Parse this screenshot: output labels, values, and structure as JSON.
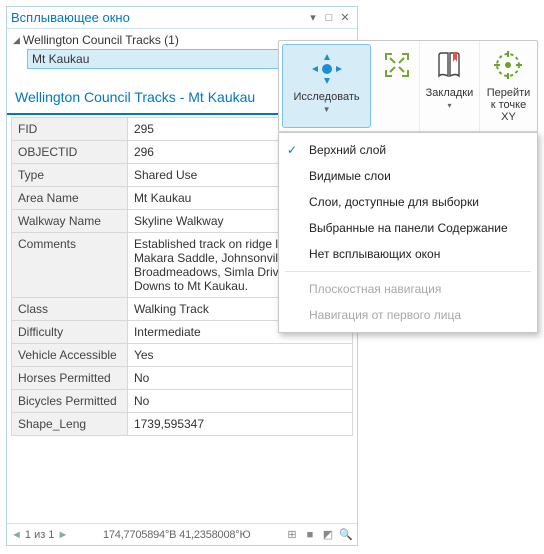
{
  "popup": {
    "title": "Всплывающее окно",
    "node": {
      "label": "Wellington Council Tracks (1)"
    },
    "leaf": {
      "label": "Mt Kaukau"
    },
    "section_title": "Wellington Council Tracks - Mt Kaukau",
    "rows": [
      {
        "k": "FID",
        "v": "295"
      },
      {
        "k": "OBJECTID",
        "v": "296"
      },
      {
        "k": "Type",
        "v": "Shared Use"
      },
      {
        "k": "Area Name",
        "v": "Mt Kaukau"
      },
      {
        "k": "Walkway Name",
        "v": "Skyline Walkway"
      },
      {
        "k": "Comments",
        "v": "Established track on ridge linking Makara Saddle, Johnsonville, Broadmeadows, Simla Drive, Crofton Downs to Mt Kaukau."
      },
      {
        "k": "Class",
        "v": "Walking Track"
      },
      {
        "k": "Difficulty",
        "v": "Intermediate"
      },
      {
        "k": "Vehicle Accessible",
        "v": "Yes"
      },
      {
        "k": "Horses Permitted",
        "v": "No"
      },
      {
        "k": "Bicycles Permitted",
        "v": "No"
      },
      {
        "k": "Shape_Leng",
        "v": "1739,595347"
      }
    ],
    "status": {
      "page": "1 из 1",
      "coords": "174,7705894°B 41,2358008°Ю"
    }
  },
  "ribbon": {
    "explore": "Исследовать",
    "zoom": "Показать всё",
    "bookmarks": "Закладки",
    "xy": "Перейти к точке XY"
  },
  "menu": {
    "items": [
      {
        "label": "Верхний слой",
        "checked": true
      },
      {
        "label": "Видимые слои"
      },
      {
        "label": "Слои, доступные для выборки"
      },
      {
        "label": "Выбранные на панели Содержание"
      },
      {
        "label": "Нет всплывающих окон"
      }
    ],
    "disabled": [
      {
        "label": "Плоскостная навигация"
      },
      {
        "label": "Навигация от первого лица"
      }
    ]
  }
}
